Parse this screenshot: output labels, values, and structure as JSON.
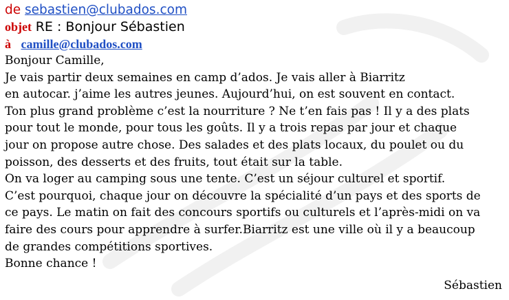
{
  "email": {
    "from_label": "de",
    "from_address": "sebastien@clubados.com",
    "subject_label": "objet",
    "subject": "RE : Bonjour Sébastien",
    "to_label": "à",
    "to_address": "camille@clubados.com"
  },
  "body": {
    "lines": [
      "Bonjour Camille,",
      "Je vais partir deux semaines en camp d’ados. Je vais aller à Biarritz",
      "en autocar. j’aime les autres jeunes. Aujourd’hui, on est souvent en contact.",
      "Ton plus grand problème c’est la nourriture ? Ne t’en fais pas ! Il y a des plats",
      "pour tout le monde, pour tous les goûts. Il y a trois repas par jour et chaque",
      "jour on propose autre chose. Des salades et des plats locaux, du poulet ou du",
      "poisson, des desserts et des fruits, tout était sur la table.",
      "On va loger au camping sous une tente. C’est un séjour culturel et sportif.",
      "C’est pourquoi, chaque jour on découvre la spécialité d’un pays et des sports de",
      "ce pays. Le matin on fait des concours sportifs ou culturels et l’après-midi on va",
      "faire des cours pour apprendre à surfer.Biarritz est une ville où il y a beaucoup",
      "de grandes compétitions sportives.",
      "Bonne chance !"
    ],
    "signature": "Sébastien"
  }
}
